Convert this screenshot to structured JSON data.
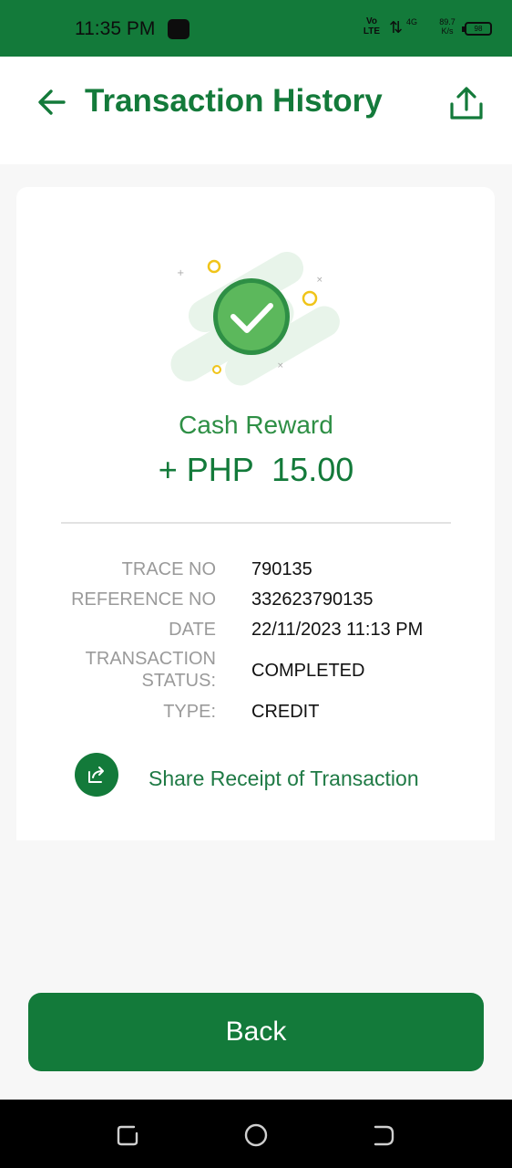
{
  "status_bar": {
    "time": "11:35 PM",
    "volte": "Vo LTE",
    "data_arrows": "⇅",
    "signal": "4G",
    "speed": "89.7 K/s",
    "battery": "98"
  },
  "header": {
    "title": "Transaction History"
  },
  "receipt": {
    "reward_label": "Cash Reward",
    "amount": "+ PHP  15.00",
    "details": [
      {
        "label": "TRACE NO",
        "value": "790135"
      },
      {
        "label": "REFERENCE NO",
        "value": "332623790135"
      },
      {
        "label": "DATE",
        "value": "22/11/2023 11:13 PM"
      },
      {
        "label": "TRANSACTION STATUS:",
        "value": "COMPLETED"
      },
      {
        "label": "TYPE:",
        "value": "CREDIT"
      }
    ],
    "share_label": "Share Receipt of Transaction"
  },
  "footer": {
    "back_label": "Back"
  },
  "colors": {
    "brand_green": "#137a3a",
    "accent_green": "#2e8f45",
    "check_green": "#5cb85c",
    "ring_yellow": "#f0c419"
  }
}
